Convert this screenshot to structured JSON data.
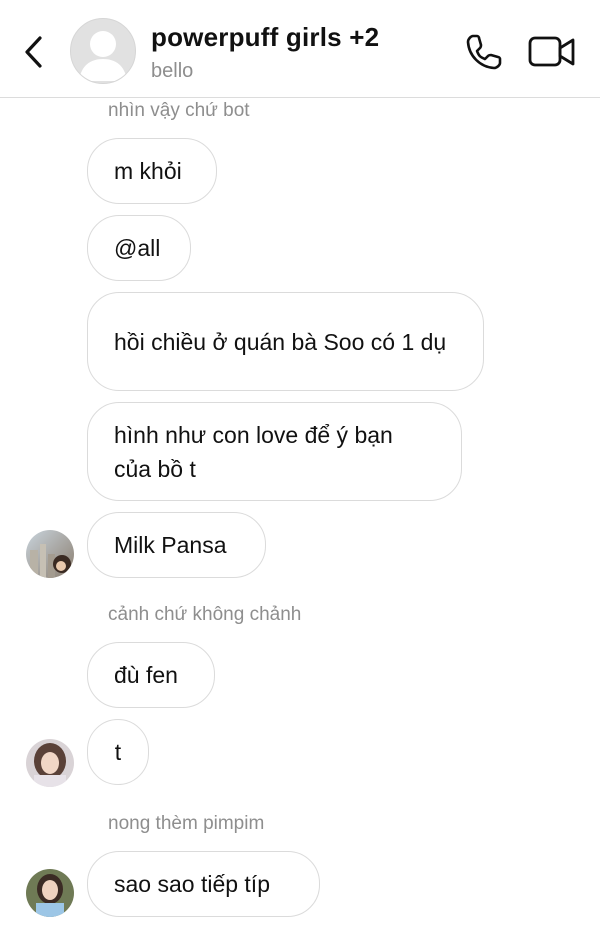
{
  "header": {
    "title": "powerpuff girls +2",
    "subtitle": "bello",
    "icons": {
      "back": "chevron-left-icon",
      "call": "phone-icon",
      "video": "video-camera-icon"
    }
  },
  "messages": [
    {
      "sender": "nhìn vậy chứ bot",
      "text": "m khỏi"
    },
    {
      "text": "@all"
    },
    {
      "text": "hồi chiều ở quán bà Soo có 1 dụ"
    },
    {
      "text": "hình như con love để ý bạn của bồ t"
    },
    {
      "text": "Milk Pansa",
      "avatar": true
    },
    {
      "sender": "cảnh chứ không chảnh",
      "text": "đù fen"
    },
    {
      "text": "t",
      "avatar": true
    },
    {
      "sender": "nong thèm pimpim",
      "text": "sao sao tiếp típ",
      "avatar": true
    }
  ],
  "colors": {
    "bubble_border": "#dbdbdb",
    "muted_text": "#8e8e8e",
    "text": "#111111",
    "divider": "#dcdcdc"
  }
}
